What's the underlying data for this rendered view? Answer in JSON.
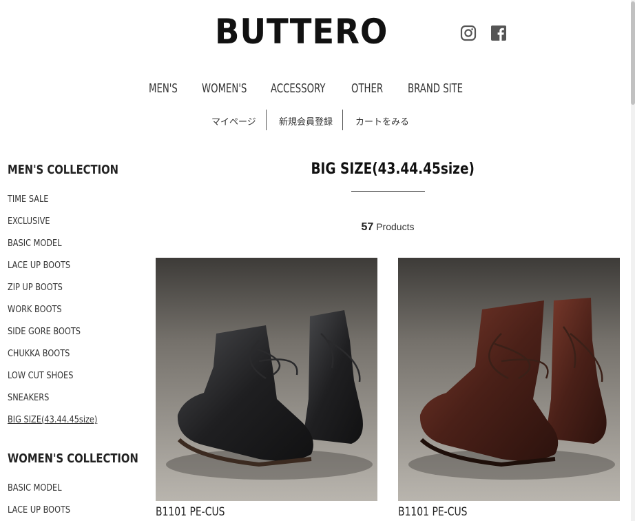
{
  "header": {
    "logo_text": "BUTTERO",
    "social": [
      {
        "icon": "instagram-icon"
      },
      {
        "icon": "facebook-icon"
      }
    ]
  },
  "main_nav": [
    "MEN'S",
    "WOMEN'S",
    "ACCESSORY",
    "OTHER",
    "BRAND SITE"
  ],
  "sub_nav": [
    "マイページ",
    "新規会員登録",
    "カートをみる"
  ],
  "sidebar": {
    "mens_heading": "MEN'S COLLECTION",
    "mens_items": [
      "TIME SALE",
      "EXCLUSIVE",
      "BASIC MODEL",
      "LACE UP BOOTS",
      "ZIP UP BOOTS",
      "WORK BOOTS",
      "SIDE GORE BOOTS",
      "CHUKKA BOOTS",
      "LOW CUT SHOES",
      "SNEAKERS",
      "BIG SIZE(43.44.45size)"
    ],
    "womens_heading": "WOMEN'S COLLECTION",
    "womens_items": [
      "BASIC MODEL",
      "LACE UP BOOTS"
    ]
  },
  "main": {
    "title": "BIG SIZE(43.44.45size)",
    "count_number": "57",
    "count_label": "Products",
    "products": [
      {
        "name": "B1101 PE-CUS",
        "color": "#1f1f21"
      },
      {
        "name": "B1101 PE-CUS",
        "color": "#4a2018"
      }
    ]
  }
}
